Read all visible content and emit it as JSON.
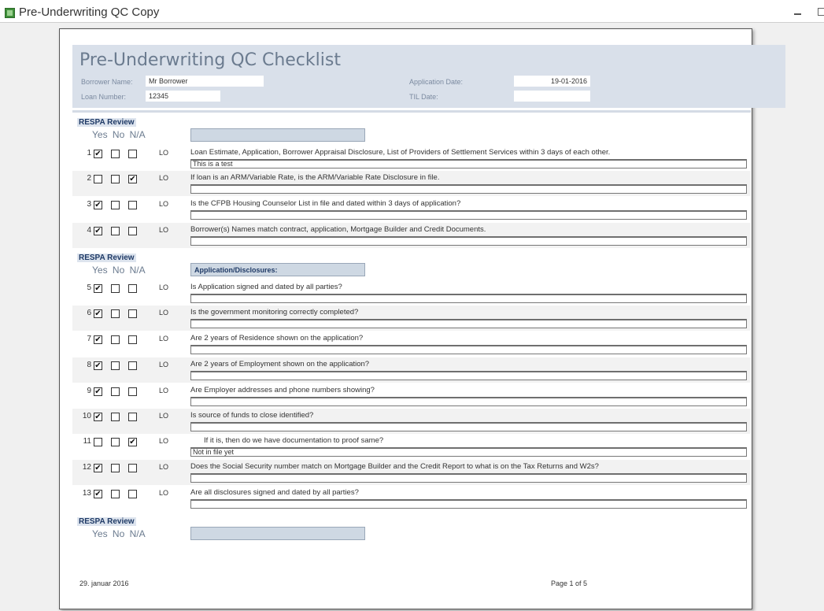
{
  "window": {
    "title": "Pre-Underwriting QC Copy"
  },
  "report": {
    "title": "Pre-Underwriting QC Checklist",
    "borrower_label": "Borrower Name:",
    "borrower_value": "Mr Borrower",
    "loan_label": "Loan Number:",
    "loan_value": "12345",
    "app_date_label": "Application Date:",
    "app_date_value": "19-01-2016",
    "til_label": "TIL Date:",
    "til_value": ""
  },
  "sections": [
    {
      "title": "RESPA Review",
      "yes_no_na": "Yes No N/A",
      "box_label": ""
    },
    {
      "title": "RESPA Review",
      "yes_no_na": "Yes No N/A",
      "box_label": "Application/Disclosures:"
    },
    {
      "title": "RESPA Review",
      "yes_no_na": "Yes No N/A",
      "box_label": ""
    }
  ],
  "questions": [
    {
      "num": "1",
      "yes": "✔",
      "no": "",
      "na": "",
      "role": "LO",
      "text": "Loan Estimate, Application, Borrower Appraisal Disclosure, List of Providers of Settlement Services within 3 days of each other.",
      "comment": "This is a test"
    },
    {
      "num": "2",
      "yes": "",
      "no": "",
      "na": "✔",
      "role": "LO",
      "text": "If loan is an ARM/Variable Rate, is the ARM/Variable Rate Disclosure in file.",
      "comment": ""
    },
    {
      "num": "3",
      "yes": "✔",
      "no": "",
      "na": "",
      "role": "LO",
      "text": "Is the CFPB Housing Counselor List in file and dated within 3 days of application?",
      "comment": ""
    },
    {
      "num": "4",
      "yes": "✔",
      "no": "",
      "na": "",
      "role": "LO",
      "text": "Borrower(s) Names match contract, application, Mortgage Builder and Credit Documents.",
      "comment": ""
    },
    {
      "num": "5",
      "yes": "✔",
      "no": "",
      "na": "",
      "role": "LO",
      "text": "Is Application signed and dated by all parties?",
      "comment": ""
    },
    {
      "num": "6",
      "yes": "✔",
      "no": "",
      "na": "",
      "role": "LO",
      "text": "Is the government monitoring correctly completed?",
      "comment": ""
    },
    {
      "num": "7",
      "yes": "✔",
      "no": "",
      "na": "",
      "role": "LO",
      "text": "Are 2 years of Residence shown on the application?",
      "comment": ""
    },
    {
      "num": "8",
      "yes": "✔",
      "no": "",
      "na": "",
      "role": "LO",
      "text": "Are 2 years of Employment shown on the application?",
      "comment": ""
    },
    {
      "num": "9",
      "yes": "✔",
      "no": "",
      "na": "",
      "role": "LO",
      "text": "Are Employer addresses and phone numbers showing?",
      "comment": ""
    },
    {
      "num": "10",
      "yes": "✔",
      "no": "",
      "na": "",
      "role": "LO",
      "text": "Is source of funds to close identified?",
      "comment": ""
    },
    {
      "num": "11",
      "yes": "",
      "no": "",
      "na": "✔",
      "role": "LO",
      "text": "If it is, then do we have documentation to proof same?",
      "comment": "Not in file yet"
    },
    {
      "num": "12",
      "yes": "✔",
      "no": "",
      "na": "",
      "role": "LO",
      "text": "Does the Social Security number match on Mortgage Builder and the Credit Report to what is on the Tax Returns and W2s?",
      "comment": ""
    },
    {
      "num": "13",
      "yes": "✔",
      "no": "",
      "na": "",
      "role": "LO",
      "text": "Are all disclosures signed and dated by all parties?",
      "comment": ""
    }
  ],
  "footer": {
    "date": "29. januar 2016",
    "page": "Page 1 of 5"
  }
}
